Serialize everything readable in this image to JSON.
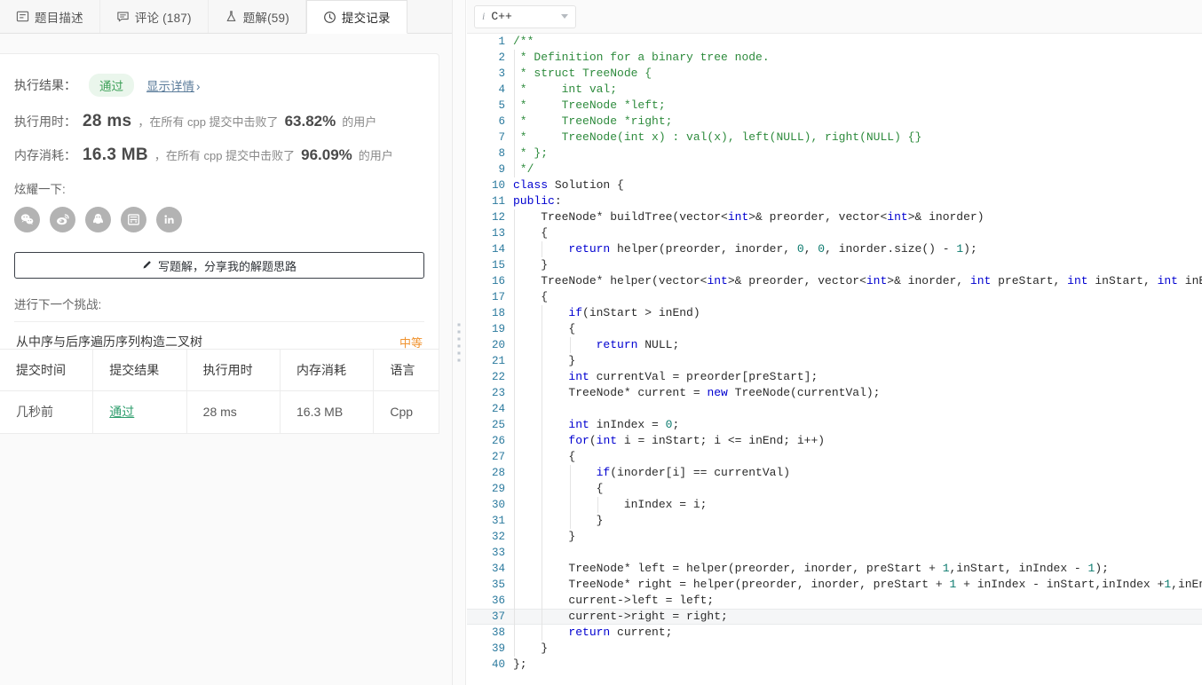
{
  "tabs": [
    {
      "id": "description",
      "label": "题目描述",
      "icon": "document-icon",
      "active": false
    },
    {
      "id": "comments",
      "label": "评论 (187)",
      "icon": "comment-icon",
      "active": false
    },
    {
      "id": "solutions",
      "label": "题解(59)",
      "icon": "flask-icon",
      "active": false
    },
    {
      "id": "submissions",
      "label": "提交记录",
      "icon": "clock-icon",
      "active": true
    }
  ],
  "result_card": {
    "result_label": "执行结果：",
    "result_badge": "通过",
    "detail_link": "显示详情",
    "detail_chevron": "›",
    "runtime": {
      "lead": "执行用时：",
      "value": "28 ms",
      "mid": "，在所有 cpp 提交中击败了",
      "percent": "63.82%",
      "tail": "的用户"
    },
    "memory": {
      "lead": "内存消耗：",
      "value": "16.3 MB",
      "mid": "，在所有 cpp 提交中击败了",
      "percent": "96.09%",
      "tail": "的用户"
    },
    "share_label": "炫耀一下:",
    "share_buttons": [
      {
        "id": "wechat",
        "icon": "wechat-icon"
      },
      {
        "id": "weibo",
        "icon": "weibo-icon"
      },
      {
        "id": "qq",
        "icon": "qq-penguin-icon"
      },
      {
        "id": "douban",
        "icon": "douban-icon"
      },
      {
        "id": "linkedin",
        "icon": "linkedin-icon"
      }
    ],
    "write_button": "写题解，分享我的解题思路",
    "write_button_icon": "pencil-icon",
    "next_challenge_label": "进行下一个挑战:",
    "next_problem_title": "从中序与后序遍历序列构造二叉树",
    "next_problem_difficulty": "中等"
  },
  "submissions_table": {
    "headers": [
      "提交时间",
      "提交结果",
      "执行用时",
      "内存消耗",
      "语言"
    ],
    "rows": [
      {
        "time": "几秒前",
        "result": "通过",
        "runtime": "28 ms",
        "memory": "16.3 MB",
        "language": "Cpp"
      }
    ]
  },
  "editor": {
    "language": "C++",
    "info_icon": "info-italic-icon",
    "caret_icon": "chevron-down-icon",
    "active_line": 37,
    "lines": [
      {
        "n": 1,
        "guides": 0,
        "tokens": [
          [
            "c",
            "/**"
          ]
        ]
      },
      {
        "n": 2,
        "guides": 1,
        "tokens": [
          [
            "c",
            " * Definition for a binary tree node."
          ]
        ]
      },
      {
        "n": 3,
        "guides": 1,
        "tokens": [
          [
            "c",
            " * struct TreeNode {"
          ]
        ]
      },
      {
        "n": 4,
        "guides": 1,
        "tokens": [
          [
            "c",
            " *     int val;"
          ]
        ]
      },
      {
        "n": 5,
        "guides": 1,
        "tokens": [
          [
            "c",
            " *     TreeNode *left;"
          ]
        ]
      },
      {
        "n": 6,
        "guides": 1,
        "tokens": [
          [
            "c",
            " *     TreeNode *right;"
          ]
        ]
      },
      {
        "n": 7,
        "guides": 1,
        "tokens": [
          [
            "c",
            " *     TreeNode(int x) : val(x), left(NULL), right(NULL) {}"
          ]
        ]
      },
      {
        "n": 8,
        "guides": 1,
        "tokens": [
          [
            "c",
            " * };"
          ]
        ]
      },
      {
        "n": 9,
        "guides": 1,
        "tokens": [
          [
            "c",
            " */"
          ]
        ]
      },
      {
        "n": 10,
        "guides": 0,
        "tokens": [
          [
            "k",
            "class"
          ],
          [
            "p",
            " Solution {"
          ]
        ]
      },
      {
        "n": 11,
        "guides": 0,
        "tokens": [
          [
            "k",
            "public"
          ],
          [
            "p",
            ":"
          ]
        ]
      },
      {
        "n": 12,
        "guides": 1,
        "tokens": [
          [
            "p",
            "    TreeNode* buildTree(vector<"
          ],
          [
            "k",
            "int"
          ],
          [
            "p",
            ">& preorder, vector<"
          ],
          [
            "k",
            "int"
          ],
          [
            "p",
            ">& inorder)"
          ]
        ]
      },
      {
        "n": 13,
        "guides": 1,
        "tokens": [
          [
            "p",
            "    {"
          ]
        ]
      },
      {
        "n": 14,
        "guides": 2,
        "tokens": [
          [
            "p",
            "        "
          ],
          [
            "k",
            "return"
          ],
          [
            "p",
            " helper(preorder, inorder, "
          ],
          [
            "n",
            "0"
          ],
          [
            "p",
            ", "
          ],
          [
            "n",
            "0"
          ],
          [
            "p",
            ", inorder.size() - "
          ],
          [
            "n",
            "1"
          ],
          [
            "p",
            ");"
          ]
        ]
      },
      {
        "n": 15,
        "guides": 1,
        "tokens": [
          [
            "p",
            "    }"
          ]
        ]
      },
      {
        "n": 16,
        "guides": 1,
        "tokens": [
          [
            "p",
            "    TreeNode* helper(vector<"
          ],
          [
            "k",
            "int"
          ],
          [
            "p",
            ">& preorder, vector<"
          ],
          [
            "k",
            "int"
          ],
          [
            "p",
            ">& inorder, "
          ],
          [
            "k",
            "int"
          ],
          [
            "p",
            " preStart, "
          ],
          [
            "k",
            "int"
          ],
          [
            "p",
            " inStart, "
          ],
          [
            "k",
            "int"
          ],
          [
            "p",
            " inEnd)"
          ]
        ]
      },
      {
        "n": 17,
        "guides": 1,
        "tokens": [
          [
            "p",
            "    {"
          ]
        ]
      },
      {
        "n": 18,
        "guides": 2,
        "tokens": [
          [
            "p",
            "        "
          ],
          [
            "k",
            "if"
          ],
          [
            "p",
            "(inStart > inEnd)"
          ]
        ]
      },
      {
        "n": 19,
        "guides": 2,
        "tokens": [
          [
            "p",
            "        {"
          ]
        ]
      },
      {
        "n": 20,
        "guides": 3,
        "tokens": [
          [
            "p",
            "            "
          ],
          [
            "k",
            "return"
          ],
          [
            "p",
            " NULL;"
          ]
        ]
      },
      {
        "n": 21,
        "guides": 2,
        "tokens": [
          [
            "p",
            "        }"
          ]
        ]
      },
      {
        "n": 22,
        "guides": 2,
        "tokens": [
          [
            "p",
            "        "
          ],
          [
            "k",
            "int"
          ],
          [
            "p",
            " currentVal = preorder[preStart];"
          ]
        ]
      },
      {
        "n": 23,
        "guides": 2,
        "tokens": [
          [
            "p",
            "        TreeNode* current = "
          ],
          [
            "k",
            "new"
          ],
          [
            "p",
            " TreeNode(currentVal);"
          ]
        ]
      },
      {
        "n": 24,
        "guides": 2,
        "tokens": [
          [
            "p",
            ""
          ]
        ]
      },
      {
        "n": 25,
        "guides": 2,
        "tokens": [
          [
            "p",
            "        "
          ],
          [
            "k",
            "int"
          ],
          [
            "p",
            " inIndex = "
          ],
          [
            "n",
            "0"
          ],
          [
            "p",
            ";"
          ]
        ]
      },
      {
        "n": 26,
        "guides": 2,
        "tokens": [
          [
            "p",
            "        "
          ],
          [
            "k",
            "for"
          ],
          [
            "p",
            "("
          ],
          [
            "k",
            "int"
          ],
          [
            "p",
            " i = inStart; i <= inEnd; i++)"
          ]
        ]
      },
      {
        "n": 27,
        "guides": 2,
        "tokens": [
          [
            "p",
            "        {"
          ]
        ]
      },
      {
        "n": 28,
        "guides": 3,
        "tokens": [
          [
            "p",
            "            "
          ],
          [
            "k",
            "if"
          ],
          [
            "p",
            "(inorder[i] == currentVal)"
          ]
        ]
      },
      {
        "n": 29,
        "guides": 3,
        "tokens": [
          [
            "p",
            "            {"
          ]
        ]
      },
      {
        "n": 30,
        "guides": 4,
        "tokens": [
          [
            "p",
            "                inIndex = i;"
          ]
        ]
      },
      {
        "n": 31,
        "guides": 3,
        "tokens": [
          [
            "p",
            "            }"
          ]
        ]
      },
      {
        "n": 32,
        "guides": 2,
        "tokens": [
          [
            "p",
            "        }"
          ]
        ]
      },
      {
        "n": 33,
        "guides": 2,
        "tokens": [
          [
            "p",
            ""
          ]
        ]
      },
      {
        "n": 34,
        "guides": 2,
        "tokens": [
          [
            "p",
            "        TreeNode* left = helper(preorder, inorder, preStart + "
          ],
          [
            "n",
            "1"
          ],
          [
            "p",
            ",inStart, inIndex - "
          ],
          [
            "n",
            "1"
          ],
          [
            "p",
            ");"
          ]
        ]
      },
      {
        "n": 35,
        "guides": 2,
        "tokens": [
          [
            "p",
            "        TreeNode* right = helper(preorder, inorder, preStart + "
          ],
          [
            "n",
            "1"
          ],
          [
            "p",
            " + inIndex - inStart,inIndex +"
          ],
          [
            "n",
            "1"
          ],
          [
            "p",
            ",inEnd);"
          ]
        ]
      },
      {
        "n": 36,
        "guides": 2,
        "tokens": [
          [
            "p",
            "        current->left = left;"
          ]
        ]
      },
      {
        "n": 37,
        "guides": 2,
        "tokens": [
          [
            "p",
            "        current->right = right;"
          ]
        ]
      },
      {
        "n": 38,
        "guides": 2,
        "tokens": [
          [
            "p",
            "        "
          ],
          [
            "k",
            "return"
          ],
          [
            "p",
            " current;"
          ]
        ]
      },
      {
        "n": 39,
        "guides": 1,
        "tokens": [
          [
            "p",
            "    }"
          ]
        ]
      },
      {
        "n": 40,
        "guides": 0,
        "tokens": [
          [
            "p",
            "};"
          ]
        ]
      }
    ]
  },
  "colors": {
    "pass_green": "#3fa15a",
    "pass_bg": "#eaf6ec",
    "difficulty_medium": "#f0932f",
    "link_blue": "#5a7b9a",
    "gutter_blue": "#2b7a9e",
    "comment_green": "#2e8b3d",
    "keyword_blue": "#0000d0",
    "number_teal": "#0b7a6e"
  }
}
